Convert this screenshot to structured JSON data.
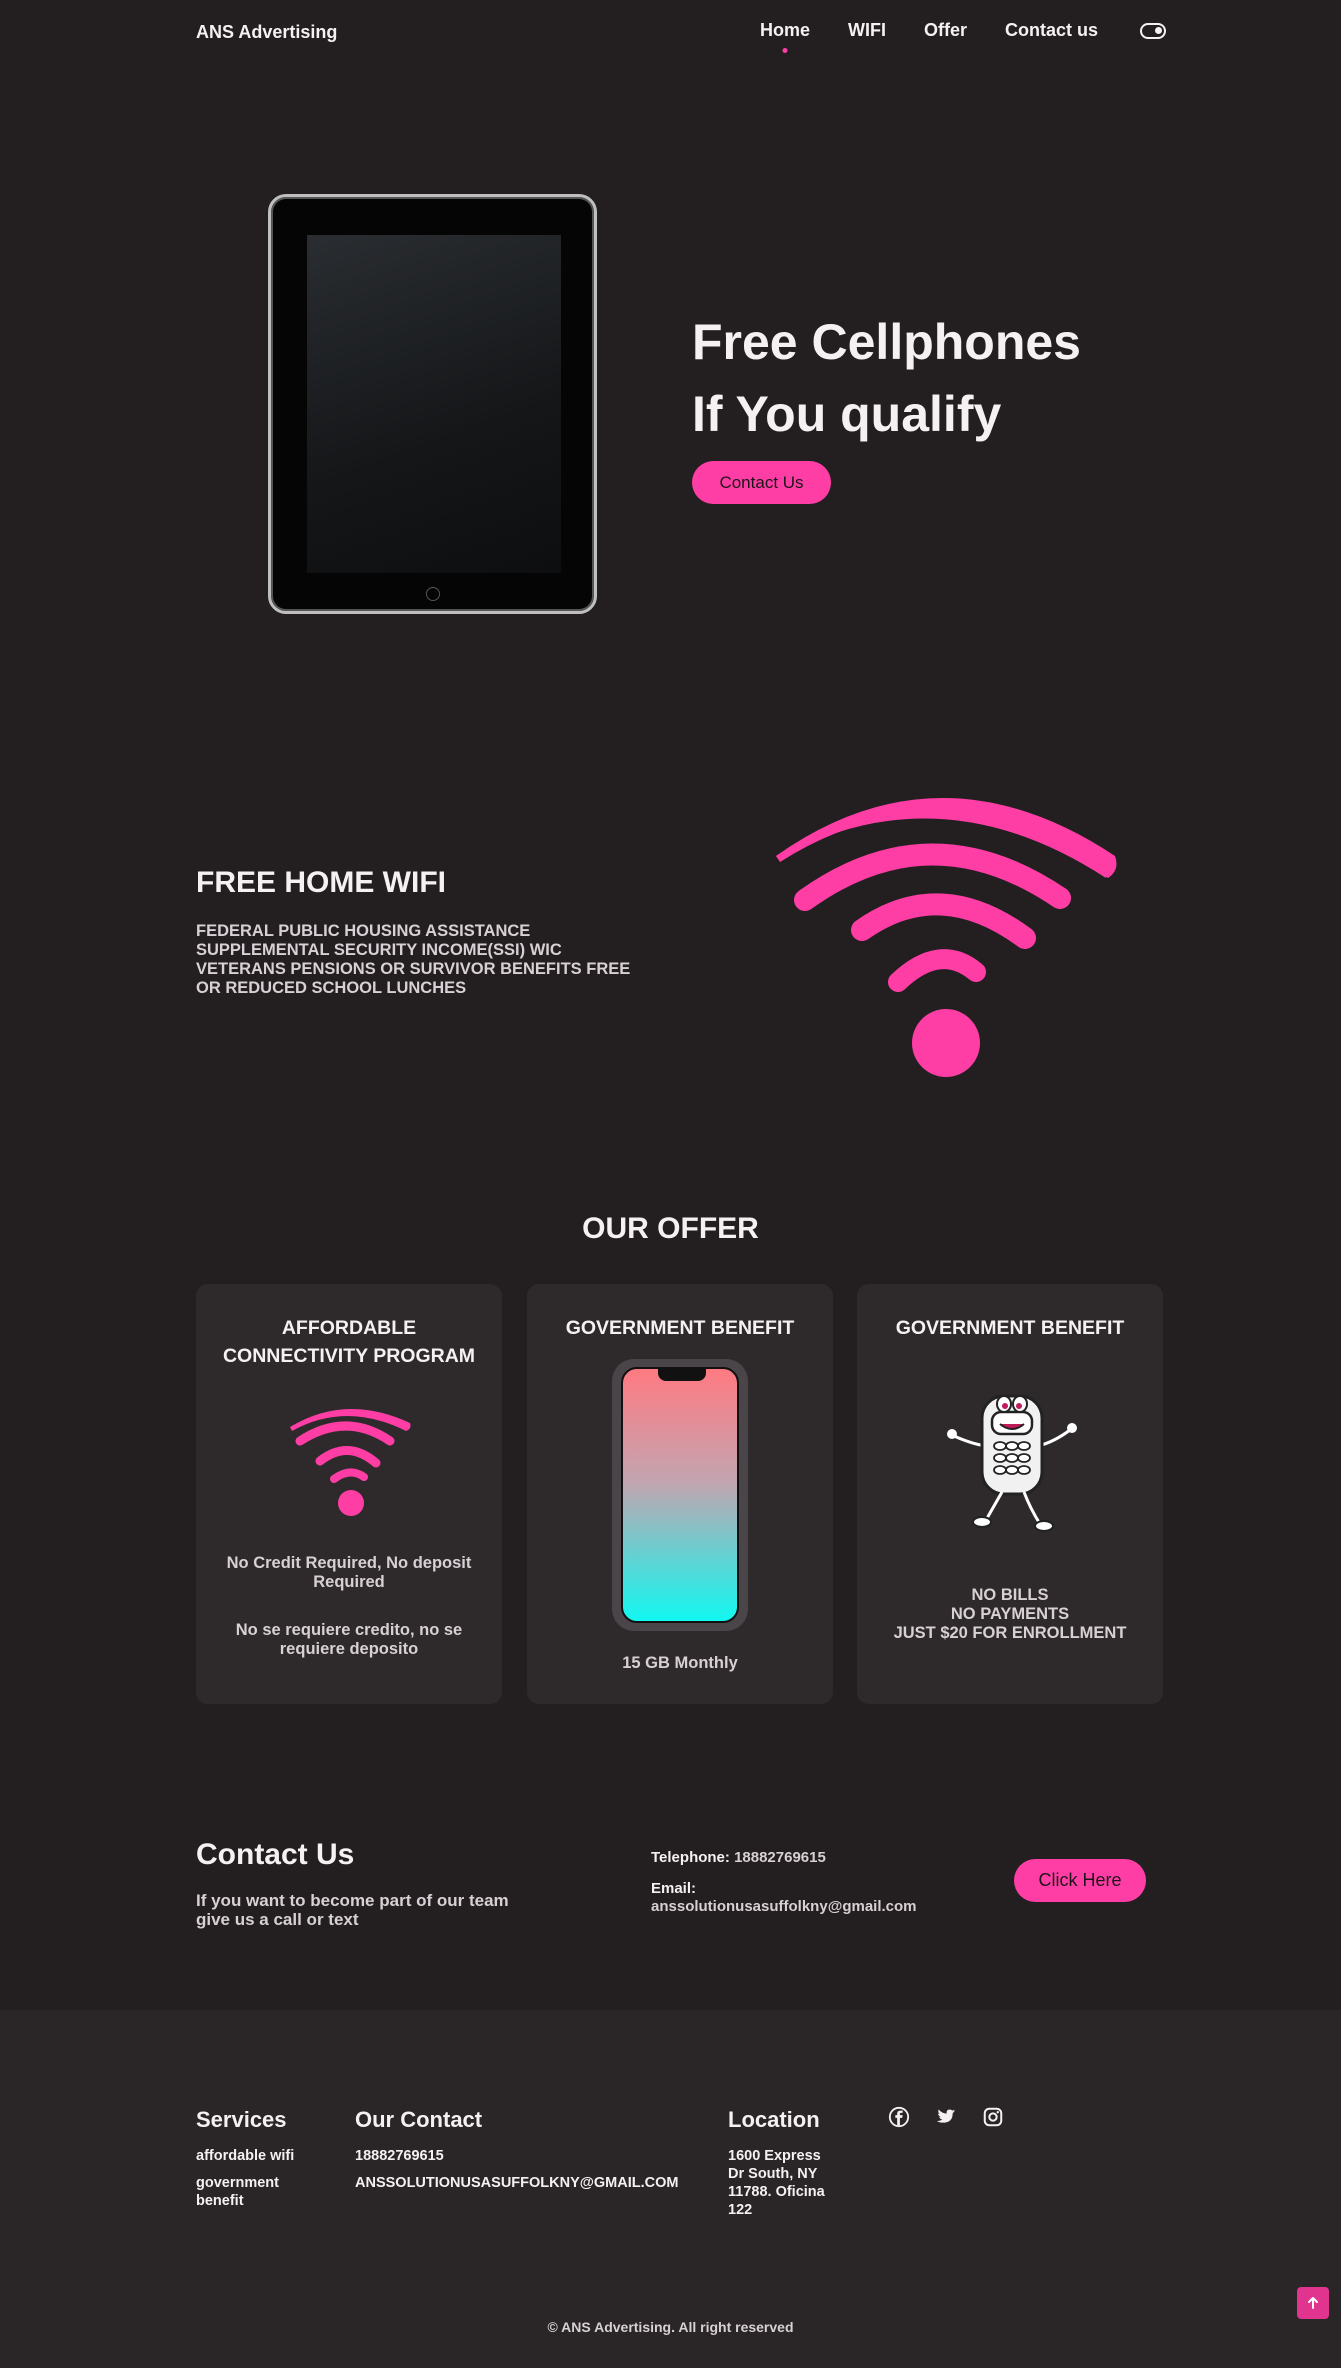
{
  "nav": {
    "brand": "ANS Advertising",
    "items": [
      {
        "label": "Home"
      },
      {
        "label": "WIFI"
      },
      {
        "label": "Offer"
      },
      {
        "label": "Contact us"
      }
    ]
  },
  "hero": {
    "title_line1": "Free Cellphones",
    "title_line2": "If You qualify",
    "button": "Contact Us"
  },
  "wifi": {
    "title": "FREE HOME WIFI",
    "text": "FEDERAL PUBLIC HOUSING ASSISTANCE SUPPLEMENTAL SECURITY INCOME(SSI) WIC VETERANS PENSIONS OR SURVIVOR BENEFITS FREE OR REDUCED SCHOOL LUNCHES"
  },
  "offer": {
    "heading": "OUR OFFER",
    "cards": [
      {
        "title": "AFFORDABLE CONNECTIVITY PROGRAM",
        "text1": "No Credit Required, No deposit Required",
        "text2": "No se requiere credito, no se requiere deposito"
      },
      {
        "title": "GOVERNMENT BENEFIT",
        "text1": "15 GB Monthly"
      },
      {
        "title": "GOVERNMENT BENEFIT",
        "line1": "NO BILLS",
        "line2": "NO PAYMENTS",
        "line3": "JUST $20 FOR ENROLLMENT"
      }
    ]
  },
  "contact": {
    "title": "Contact Us",
    "subtitle": "If you want to become part of our team give us a call or text",
    "tel_label": "Telephone:",
    "tel_value": "18882769615",
    "email_label": "Email:",
    "email_value": "anssolutionusasuffolkny@gmail.com",
    "button": "Click Here"
  },
  "footer": {
    "services_title": "Services",
    "services": [
      "affordable wifi",
      "government benefit"
    ],
    "contact_title": "Our Contact",
    "contact_phone": "18882769615",
    "contact_email": "ANSSOLUTIONUSASUFFOLKNY@GMAIL.COM",
    "location_title": "Location",
    "location_address": "1600 Express Dr South, NY 11788. Oficina 122",
    "social": [
      "facebook-icon",
      "twitter-icon",
      "instagram-icon"
    ],
    "copyright": "© ANS Advertising. All right reserved"
  },
  "colors": {
    "background": "#231f21",
    "accent": "#ff3ea5",
    "card": "#2e2a2c",
    "footer": "#2a2527"
  }
}
